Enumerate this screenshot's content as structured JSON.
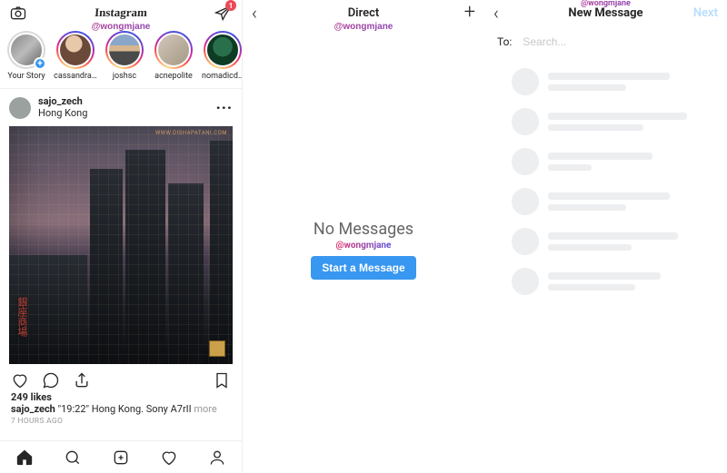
{
  "watermark": "@wongmjane",
  "feed": {
    "logo": "Instagram",
    "dm_badge": "1",
    "stories": [
      {
        "label": "Your Story",
        "self": true
      },
      {
        "label": "cassandra…"
      },
      {
        "label": "joshsc"
      },
      {
        "label": "acnepolite"
      },
      {
        "label": "nomadicd…"
      }
    ],
    "post": {
      "username": "sajo_zech",
      "location": "Hong Kong",
      "photo_watermark": "WWW.DISHAPATANI.COM",
      "likes_label": "249 likes",
      "caption": "\"19:22\" Hong Kong. Sony A7rII",
      "caption_more": "more",
      "time": "7 HOURS AGO"
    }
  },
  "direct": {
    "title": "Direct",
    "no_messages": "No Messages",
    "start_button": "Start a Message"
  },
  "newmsg": {
    "title": "New Message",
    "next": "Next",
    "to_label": "To:",
    "search_placeholder": "Search..."
  }
}
